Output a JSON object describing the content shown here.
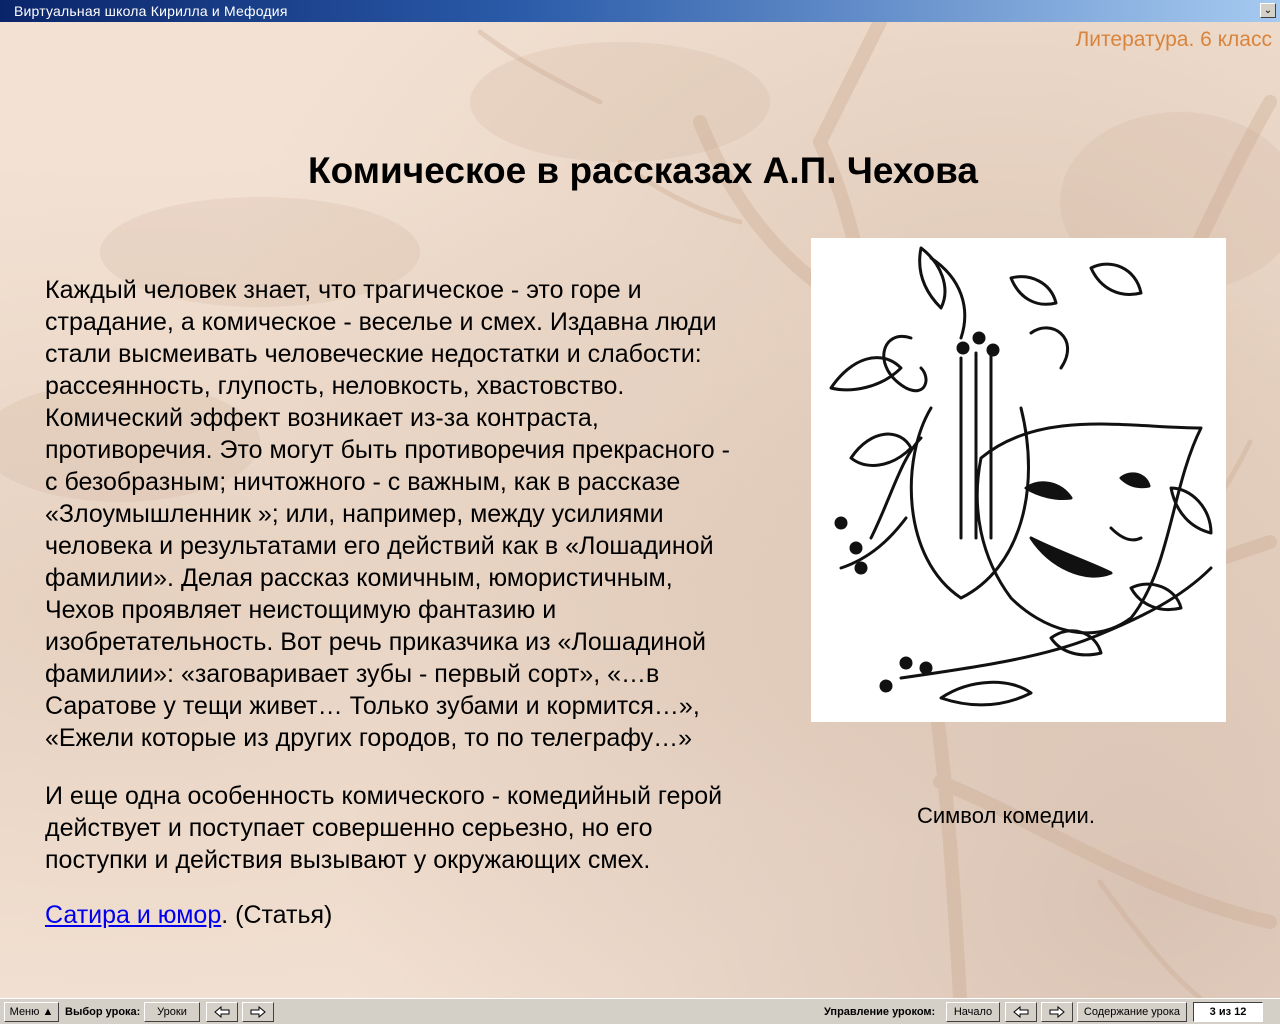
{
  "window": {
    "title": "Виртуальная школа Кирилла и Мефодия",
    "collapse_glyph": "⌄"
  },
  "header": {
    "subject": "Литература. 6 класс"
  },
  "lesson": {
    "title": "Комическое в рассказах А.П. Чехова",
    "paragraph1": [
      "Каждый человек знает, что трагическое - это горе и",
      "страдание, а комическое - веселье и смех. Издавна люди",
      "стали высмеивать человеческие недостатки и слабости:",
      "рассеянность, глупость, неловкость, хвастовство.",
      "Комический эффект возникает из-за контраста,",
      "противоречия. Это могут быть противоречия прекрасного -",
      "с безобразным; ничтожного - с важным, как в рассказе",
      "«Злоумышленник »; или, например, между усилиями",
      "человека и результатами его действий как в «Лошадиной",
      "фамилии». Делая рассказ комичным, юмористичным,",
      "Чехов проявляет неистощимую фантазию и",
      "изобретательность. Вот речь приказчика из «Лошадиной",
      "фамилии»: «заговаривает зубы - первый сорт», «…в",
      "Саратове у тещи живет… Только зубами и кормится…»,",
      "«Ежели которые из других городов, то по телеграфу…»"
    ],
    "paragraph2": [
      "И еще одна особенность комического - комедийный герой",
      "действует и поступает совершенно серьезно, но его",
      "поступки и действия вызывают у окружающих смех."
    ],
    "link_text": "Сатира и юмор",
    "link_suffix": ". (Статья)",
    "image_caption": "Символ комедии.",
    "image_icon": "comedy-mask-icon"
  },
  "toolbar": {
    "menu_label": "Меню",
    "lesson_select_label": "Выбор урока:",
    "lessons_button": "Уроки",
    "lesson_control_label": "Управление уроком:",
    "start_button": "Начало",
    "contents_button": "Содержание урока",
    "page_counter": "3 из 12"
  },
  "colors": {
    "titlebar_start": "#0a246a",
    "titlebar_end": "#a6caf0",
    "subject_text": "#d9843c",
    "background": "#f3e2d4",
    "link": "#0000ee"
  }
}
